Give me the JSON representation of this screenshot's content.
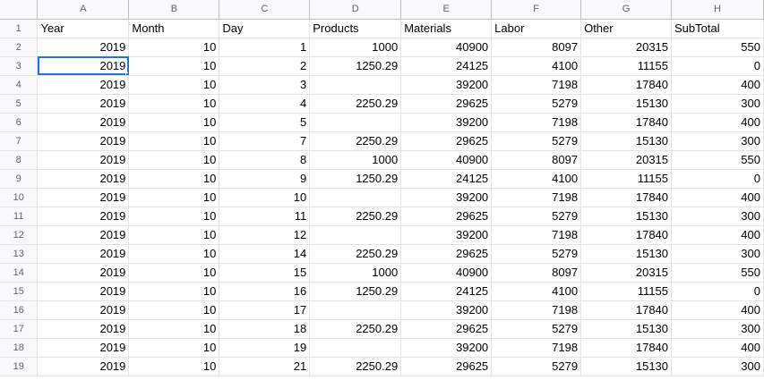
{
  "sheet": {
    "column_letters": [
      "A",
      "B",
      "C",
      "D",
      "E",
      "F",
      "G",
      "H"
    ],
    "header_row_number": "1",
    "headers": [
      "Year",
      "Month",
      "Day",
      "Products",
      "Materials",
      "Labor",
      "Other",
      "SubTotal"
    ],
    "selected_cell": "A3",
    "rows": [
      {
        "n": "2",
        "cells": [
          "2019",
          "10",
          "1",
          "1000",
          "40900",
          "8097",
          "20315",
          "550"
        ]
      },
      {
        "n": "3",
        "cells": [
          "2019",
          "10",
          "2",
          "1250.29",
          "24125",
          "4100",
          "11155",
          "0"
        ]
      },
      {
        "n": "4",
        "cells": [
          "2019",
          "10",
          "3",
          "",
          "39200",
          "7198",
          "17840",
          "400"
        ]
      },
      {
        "n": "5",
        "cells": [
          "2019",
          "10",
          "4",
          "2250.29",
          "29625",
          "5279",
          "15130",
          "300"
        ]
      },
      {
        "n": "6",
        "cells": [
          "2019",
          "10",
          "5",
          "",
          "39200",
          "7198",
          "17840",
          "400"
        ]
      },
      {
        "n": "7",
        "cells": [
          "2019",
          "10",
          "7",
          "2250.29",
          "29625",
          "5279",
          "15130",
          "300"
        ]
      },
      {
        "n": "8",
        "cells": [
          "2019",
          "10",
          "8",
          "1000",
          "40900",
          "8097",
          "20315",
          "550"
        ]
      },
      {
        "n": "9",
        "cells": [
          "2019",
          "10",
          "9",
          "1250.29",
          "24125",
          "4100",
          "11155",
          "0"
        ]
      },
      {
        "n": "10",
        "cells": [
          "2019",
          "10",
          "10",
          "",
          "39200",
          "7198",
          "17840",
          "400"
        ]
      },
      {
        "n": "11",
        "cells": [
          "2019",
          "10",
          "11",
          "2250.29",
          "29625",
          "5279",
          "15130",
          "300"
        ]
      },
      {
        "n": "12",
        "cells": [
          "2019",
          "10",
          "12",
          "",
          "39200",
          "7198",
          "17840",
          "400"
        ]
      },
      {
        "n": "13",
        "cells": [
          "2019",
          "10",
          "14",
          "2250.29",
          "29625",
          "5279",
          "15130",
          "300"
        ]
      },
      {
        "n": "14",
        "cells": [
          "2019",
          "10",
          "15",
          "1000",
          "40900",
          "8097",
          "20315",
          "550"
        ]
      },
      {
        "n": "15",
        "cells": [
          "2019",
          "10",
          "16",
          "1250.29",
          "24125",
          "4100",
          "11155",
          "0"
        ]
      },
      {
        "n": "16",
        "cells": [
          "2019",
          "10",
          "17",
          "",
          "39200",
          "7198",
          "17840",
          "400"
        ]
      },
      {
        "n": "17",
        "cells": [
          "2019",
          "10",
          "18",
          "2250.29",
          "29625",
          "5279",
          "15130",
          "300"
        ]
      },
      {
        "n": "18",
        "cells": [
          "2019",
          "10",
          "19",
          "",
          "39200",
          "7198",
          "17840",
          "400"
        ]
      },
      {
        "n": "19",
        "cells": [
          "2019",
          "10",
          "21",
          "2250.29",
          "29625",
          "5279",
          "15130",
          "300"
        ]
      }
    ]
  }
}
